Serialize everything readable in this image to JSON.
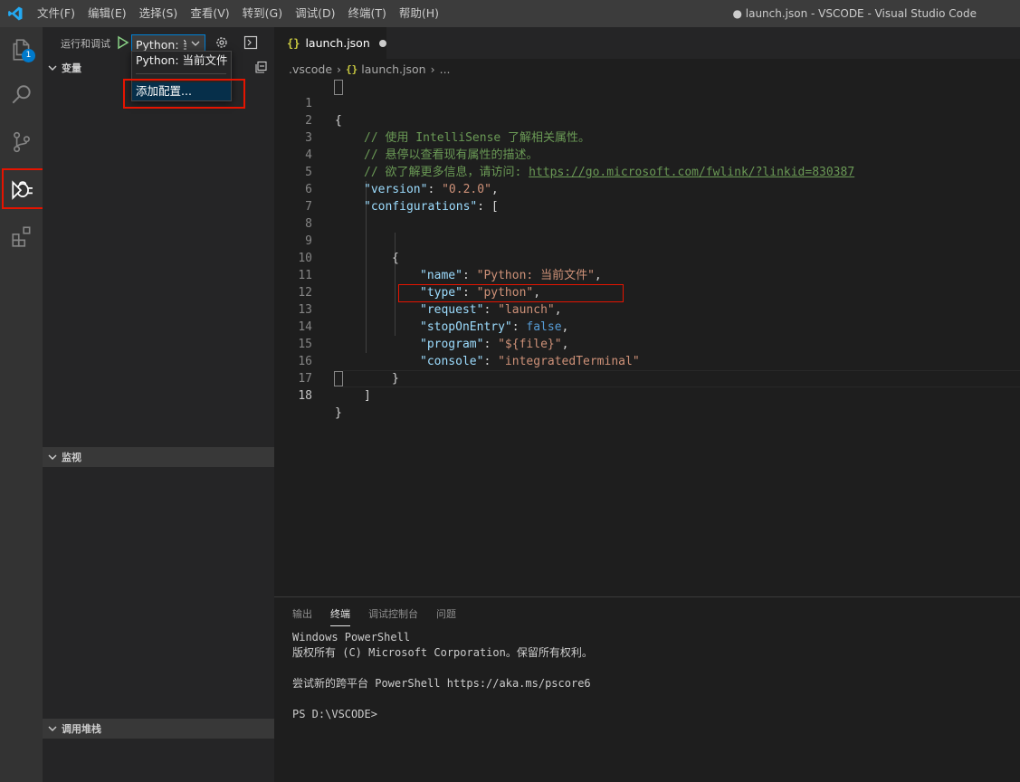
{
  "titlebar": {
    "menu": [
      "文件(F)",
      "编辑(E)",
      "选择(S)",
      "查看(V)",
      "转到(G)",
      "调试(D)",
      "终端(T)",
      "帮助(H)"
    ],
    "window_title": "● launch.json - VSCODE - Visual Studio Code"
  },
  "activitybar": {
    "badge_count": "1",
    "icons": [
      "explorer-icon",
      "search-icon",
      "source-control-icon",
      "debug-icon",
      "extensions-icon"
    ],
    "accent_color": "#007acc",
    "highlight_color": "#e51400"
  },
  "sidebar": {
    "run_label": "运行和调试",
    "config_select_value": "Python: 当前文件",
    "sections": {
      "variables": "变量",
      "watch": "监视",
      "callstack": "调用堆栈"
    },
    "dropdown": {
      "options": [
        "Python: 当前文件",
        "添加配置..."
      ]
    }
  },
  "editor": {
    "tab_label": "launch.json",
    "tab_icon": "{}",
    "breadcrumb": [
      ".vscode",
      "launch.json",
      "..."
    ],
    "line_numbers": [
      "1",
      "2",
      "3",
      "4",
      "5",
      "6",
      "7",
      "8",
      "9",
      "10",
      "11",
      "12",
      "13",
      "14",
      "15",
      "16",
      "17",
      "18"
    ],
    "code": {
      "comment1": "// 使用 IntelliSense 了解相关属性。",
      "comment2": "// 悬停以查看现有属性的描述。",
      "comment3_prefix": "// 欲了解更多信息，请访问: ",
      "comment3_link": "https://go.microsoft.com/fwlink/?linkid=830387",
      "version_key": "\"version\"",
      "version_val": "\"0.2.0\"",
      "configs_key": "\"configurations\"",
      "name_key": "\"name\"",
      "name_val": "\"Python: 当前文件\"",
      "type_key": "\"type\"",
      "type_val": "\"python\"",
      "request_key": "\"request\"",
      "request_val": "\"launch\"",
      "stop_key": "\"stopOnEntry\"",
      "stop_val": "false",
      "program_key": "\"program\"",
      "program_val": "\"${file}\"",
      "console_key": "\"console\"",
      "console_val": "\"integratedTerminal\""
    }
  },
  "panel": {
    "tabs": [
      "输出",
      "终端",
      "调试控制台",
      "问题"
    ],
    "active_tab": "终端",
    "terminal_lines": [
      "Windows PowerShell",
      "版权所有 (C) Microsoft Corporation。保留所有权利。",
      "",
      "尝试新的跨平台 PowerShell https://aka.ms/pscore6",
      "",
      "PS D:\\VSCODE>"
    ]
  }
}
